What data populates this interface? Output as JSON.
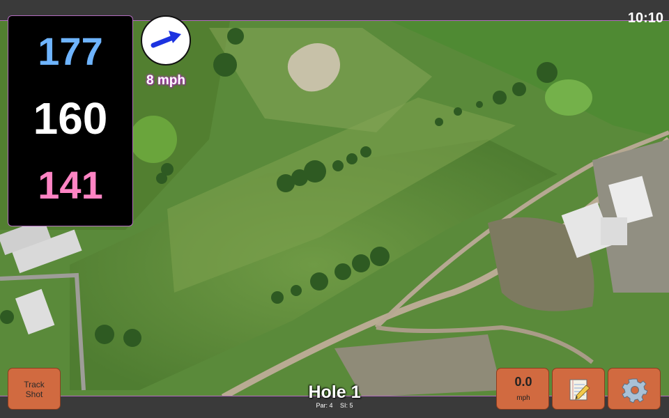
{
  "status_bar": {
    "time": "10:10"
  },
  "distances": {
    "back": "177",
    "middle": "160",
    "front": "141"
  },
  "wind": {
    "speed_text": "8 mph",
    "icon": "wind-direction-arrow-icon"
  },
  "hole": {
    "title": "Hole 1",
    "par_text": "Par: 4",
    "si_text": "SI: 5"
  },
  "buttons": {
    "track_shot_line1": "Track",
    "track_shot_line2": "Shot",
    "speed_value": "0.0",
    "speed_unit": "mph",
    "notes_icon": "notepad-icon",
    "settings_icon": "gear-icon"
  },
  "colors": {
    "back_distance": "#6eb4ff",
    "middle_distance": "#ffffff",
    "front_distance": "#ff84c4",
    "button": "#d16a40",
    "accent_border": "#b36cc0"
  }
}
